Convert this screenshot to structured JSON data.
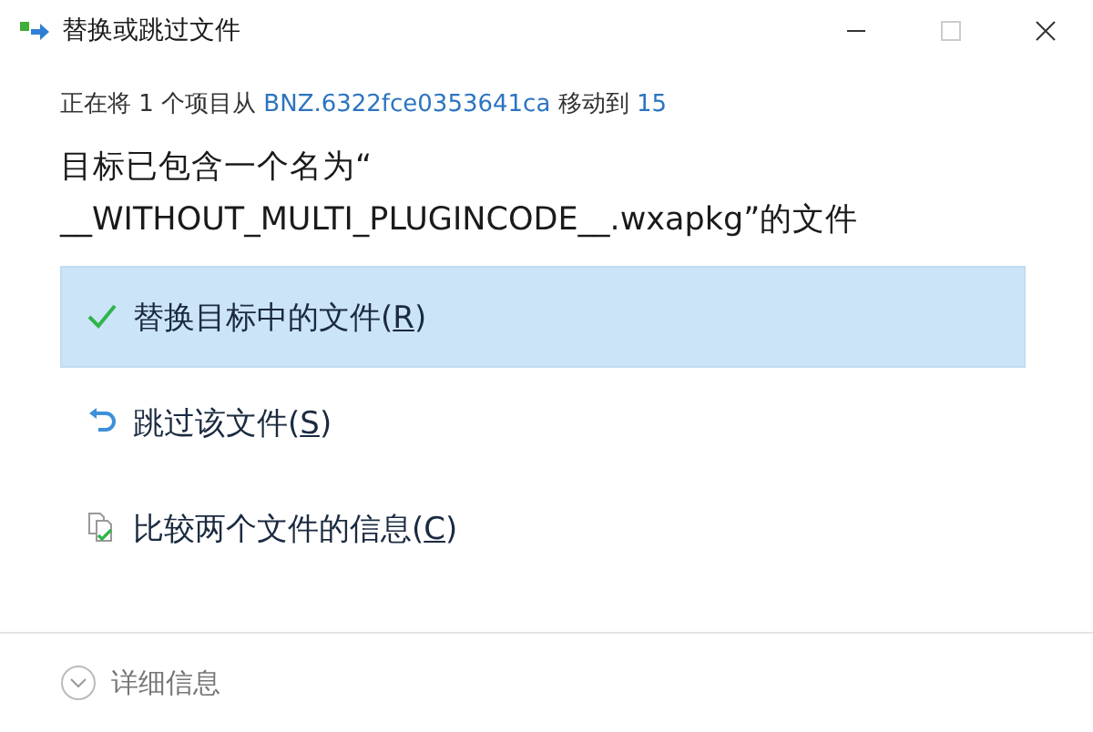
{
  "window": {
    "title": "替换或跳过文件"
  },
  "info": {
    "prefix": "正在将 1 个项目从 ",
    "source": "BNZ.6322fce0353641ca",
    "middle": " 移动到 ",
    "destination": "15"
  },
  "heading": [
    "目标已包含一个名为“",
    "__WITHOUT_MULTI_PLUGINCODE__.wxapkg”的文件"
  ],
  "options": [
    {
      "kind": "replace",
      "before": "替换目标中的文件(",
      "mnemonic": "R",
      "after": ")",
      "selected": true
    },
    {
      "kind": "skip",
      "before": "跳过该文件(",
      "mnemonic": "S",
      "after": ")",
      "selected": false
    },
    {
      "kind": "compare",
      "before": "比较两个文件的信息(",
      "mnemonic": "C",
      "after": ")",
      "selected": false
    }
  ],
  "details": {
    "label": "详细信息",
    "expanded": false
  }
}
